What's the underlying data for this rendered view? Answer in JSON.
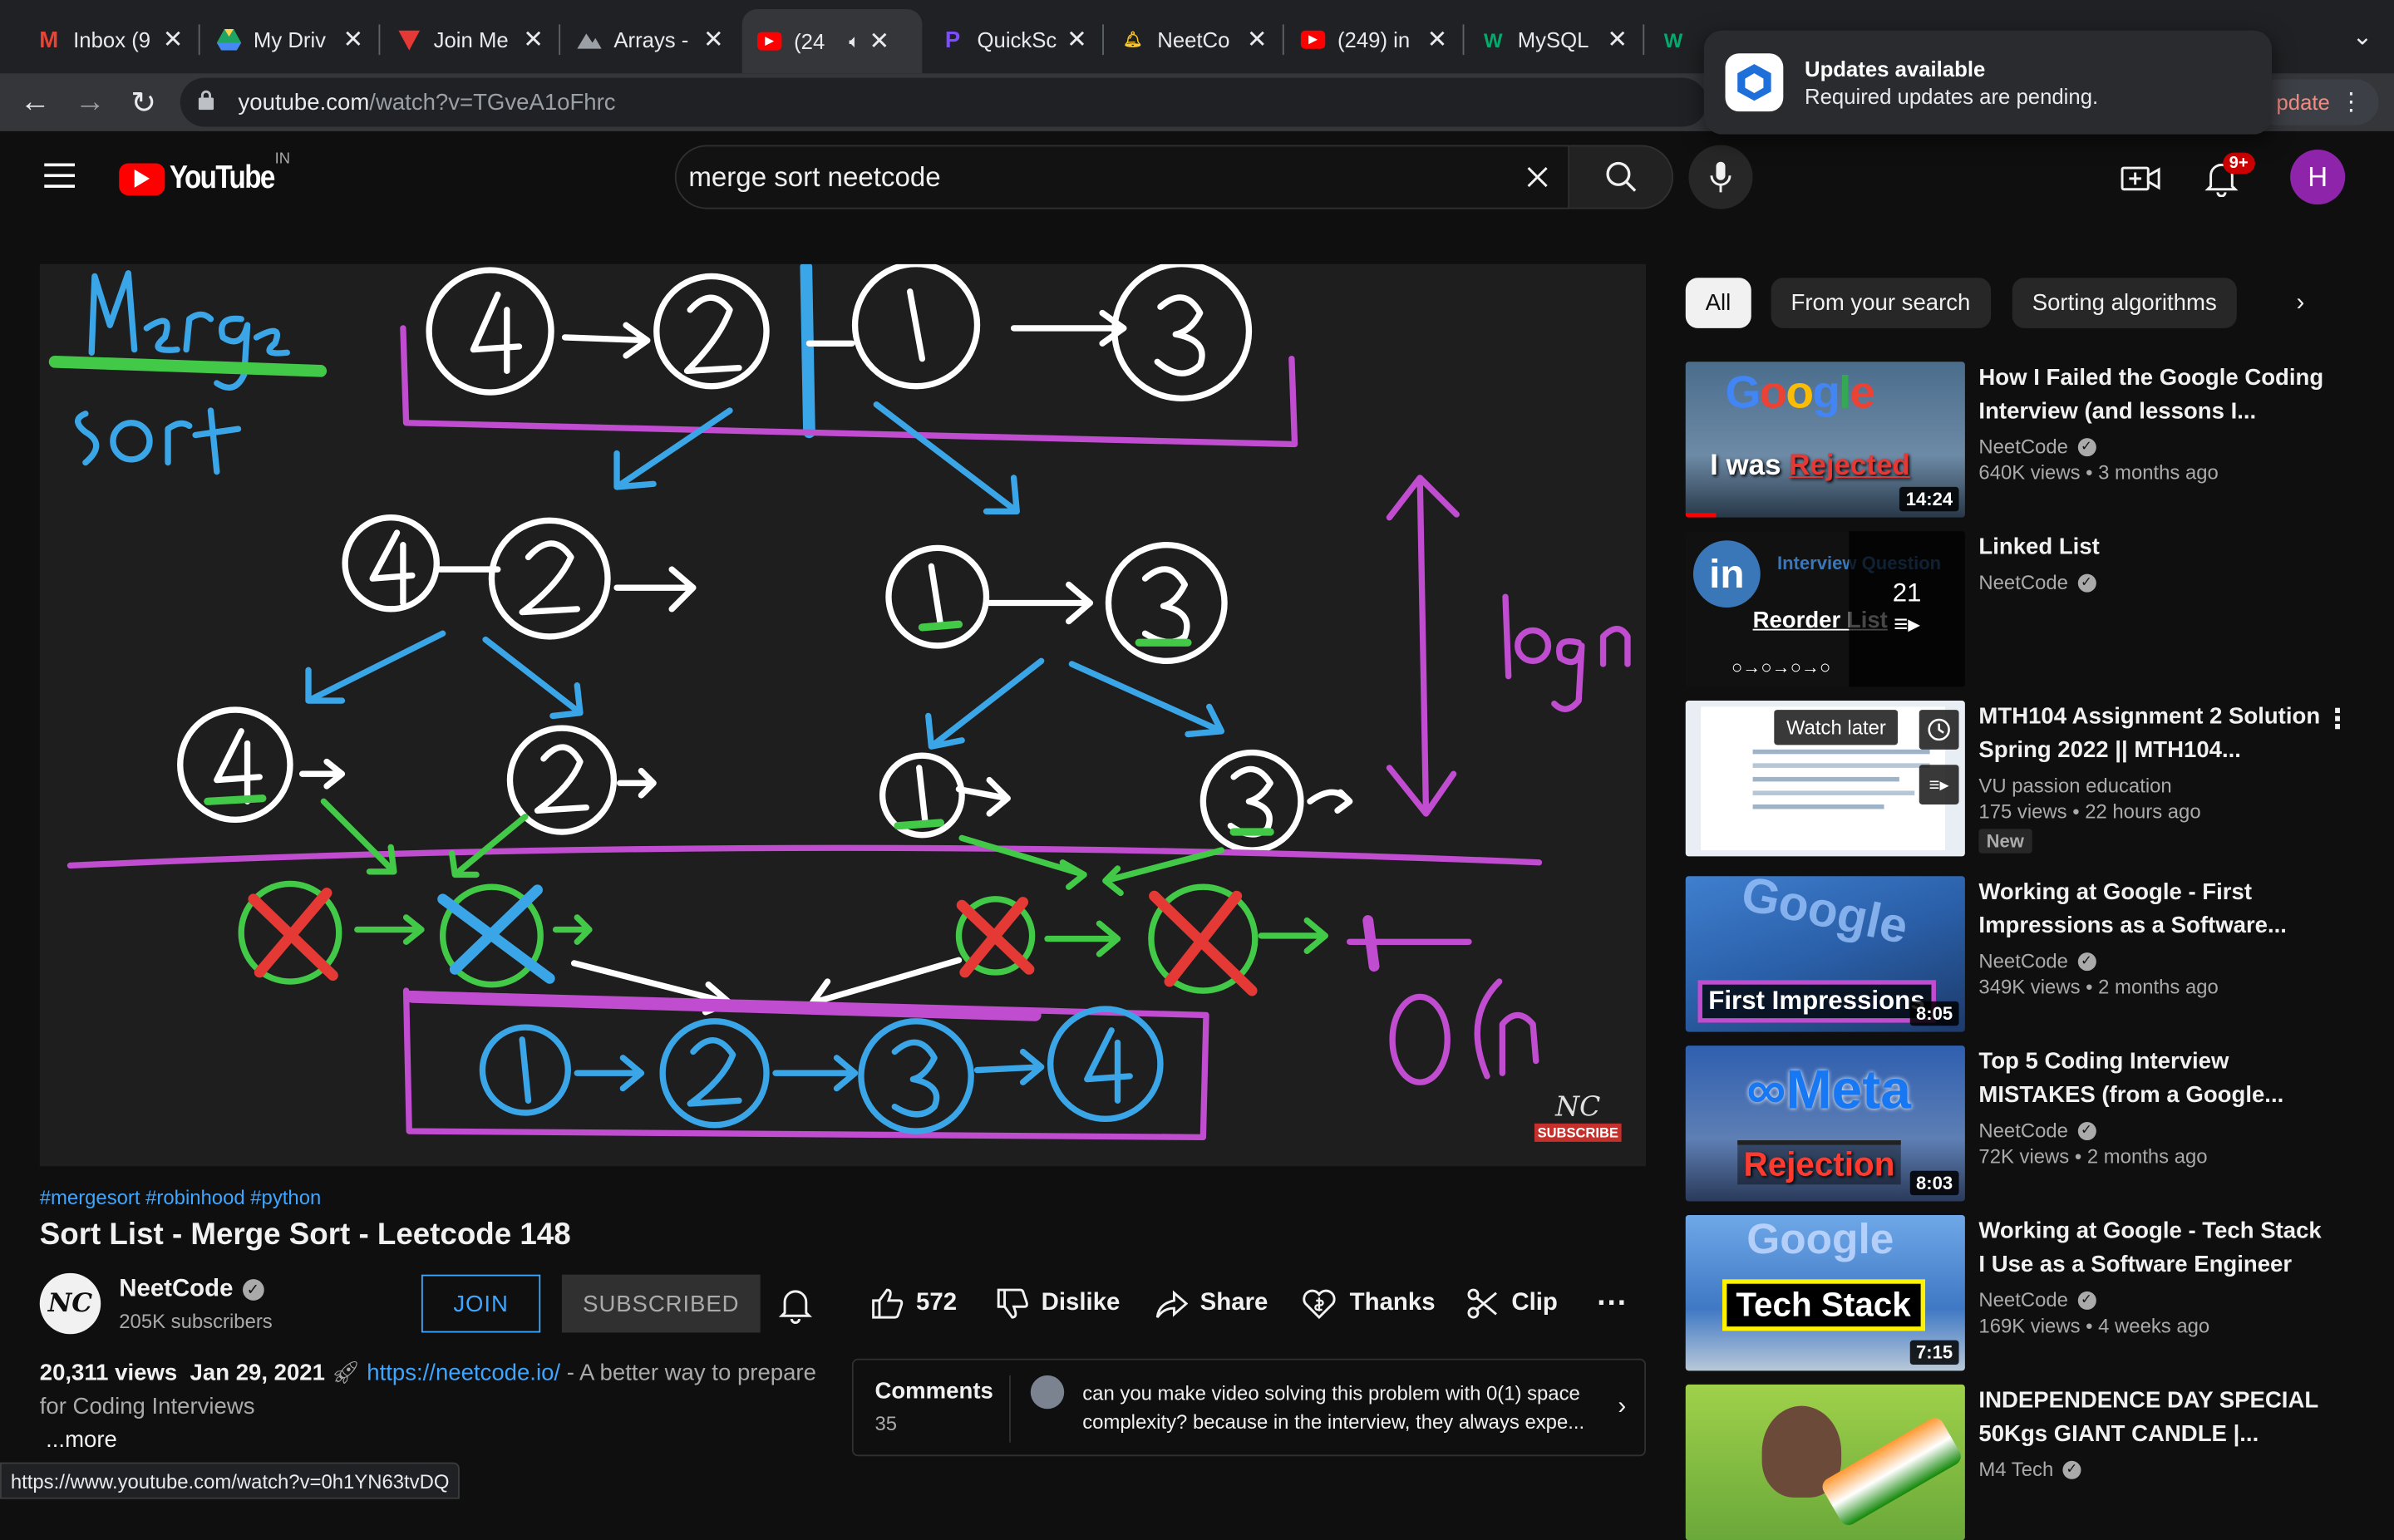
{
  "browser": {
    "tabs": [
      {
        "title": "Inbox (9",
        "icon": "gmail-icon"
      },
      {
        "title": "My Driv",
        "icon": "drive-icon"
      },
      {
        "title": "Join Me",
        "icon": "flag-icon"
      },
      {
        "title": "Arrays -",
        "icon": "mountain-icon"
      },
      {
        "title": "(24",
        "icon": "youtube-icon"
      },
      {
        "title": "QuickSc",
        "icon": "quick-icon"
      },
      {
        "title": "NeetCo",
        "icon": "bell-tab-icon"
      },
      {
        "title": "(249) in",
        "icon": "youtube-icon"
      },
      {
        "title": "MySQL",
        "icon": "w3-icon"
      }
    ],
    "url": "youtube.com",
    "url_path": "/watch?v=TGveA1oFhrc",
    "update_label": "pdate",
    "status_url": "https://www.youtube.com/watch?v=0h1YN63tvDQ"
  },
  "notification": {
    "title": "Updates available",
    "body": "Required updates are pending."
  },
  "youtube": {
    "logo": "YouTube",
    "country": "IN",
    "search_query": "merge sort neetcode",
    "notif_count": "9+",
    "avatar_letter": "H"
  },
  "video": {
    "hashtags": "#mergesort #robinhood #python",
    "title": "Sort List - Merge Sort - Leetcode 148",
    "watermark": "NC",
    "watermark_sub": "SUBSCRIBE",
    "drawing_text": {
      "title1": "Merge",
      "title2": "Sort",
      "logn": "log n",
      "on": "O(n"
    }
  },
  "channel": {
    "avatar": "NC",
    "name": "NeetCode",
    "subscribers": "205K subscribers",
    "join": "JOIN",
    "subscribed": "SUBSCRIBED"
  },
  "actions": {
    "likes": "572",
    "dislike": "Dislike",
    "share": "Share",
    "thanks": "Thanks",
    "clip": "Clip"
  },
  "description": {
    "views": "20,311 views",
    "date": "Jan 29, 2021",
    "link": "https://neetcode.io/",
    "text": " - A better way to prepare for Coding Interviews",
    "more": "...more"
  },
  "comments": {
    "header": "Comments",
    "count": "35",
    "preview": "can you make video solving this problem with 0(1) space complexity? because in the interview, they always expe..."
  },
  "sidebar": {
    "chips": [
      "All",
      "From your search",
      "Sorting algorithms"
    ],
    "recs": [
      {
        "title": "How I Failed the Google Coding Interview (and lessons I...",
        "channel": "NeetCode",
        "verified": true,
        "meta": "640K views • 3 months ago",
        "duration": "14:24",
        "thumb_text": "Google",
        "thumb_text2": "I was Rejected"
      },
      {
        "title": "Linked List",
        "channel": "NeetCode",
        "verified": true,
        "meta": "",
        "duration": "",
        "thumb_text": "Reorder List",
        "thumb_text2": "21"
      },
      {
        "title": "MTH104 Assignment 2 Solution Spring 2022 || MTH104...",
        "channel": "VU passion education",
        "verified": false,
        "meta": "175 views • 22 hours ago",
        "duration": "",
        "badge": "New",
        "thumb_text": "Watch later",
        "thumb_text2": ""
      },
      {
        "title": "Working at Google - First Impressions as a Software...",
        "channel": "NeetCode",
        "verified": true,
        "meta": "349K views • 2 months ago",
        "duration": "8:05",
        "thumb_text": "Google",
        "thumb_text2": "First Impressions"
      },
      {
        "title": "Top 5 Coding Interview MISTAKES (from a Google...",
        "channel": "NeetCode",
        "verified": true,
        "meta": "72K views • 2 months ago",
        "duration": "8:03",
        "thumb_text": "Meta",
        "thumb_text2": "Rejection"
      },
      {
        "title": "Working at Google - Tech Stack I Use as a Software Engineer",
        "channel": "NeetCode",
        "verified": true,
        "meta": "169K views • 4 weeks ago",
        "duration": "7:15",
        "thumb_text": "Google",
        "thumb_text2": "Tech Stack"
      },
      {
        "title": "INDEPENDENCE DAY SPECIAL 50Kgs GIANT CANDLE |...",
        "channel": "M4 Tech",
        "verified": true,
        "meta": "",
        "duration": "",
        "thumb_text": "",
        "thumb_text2": ""
      }
    ]
  }
}
